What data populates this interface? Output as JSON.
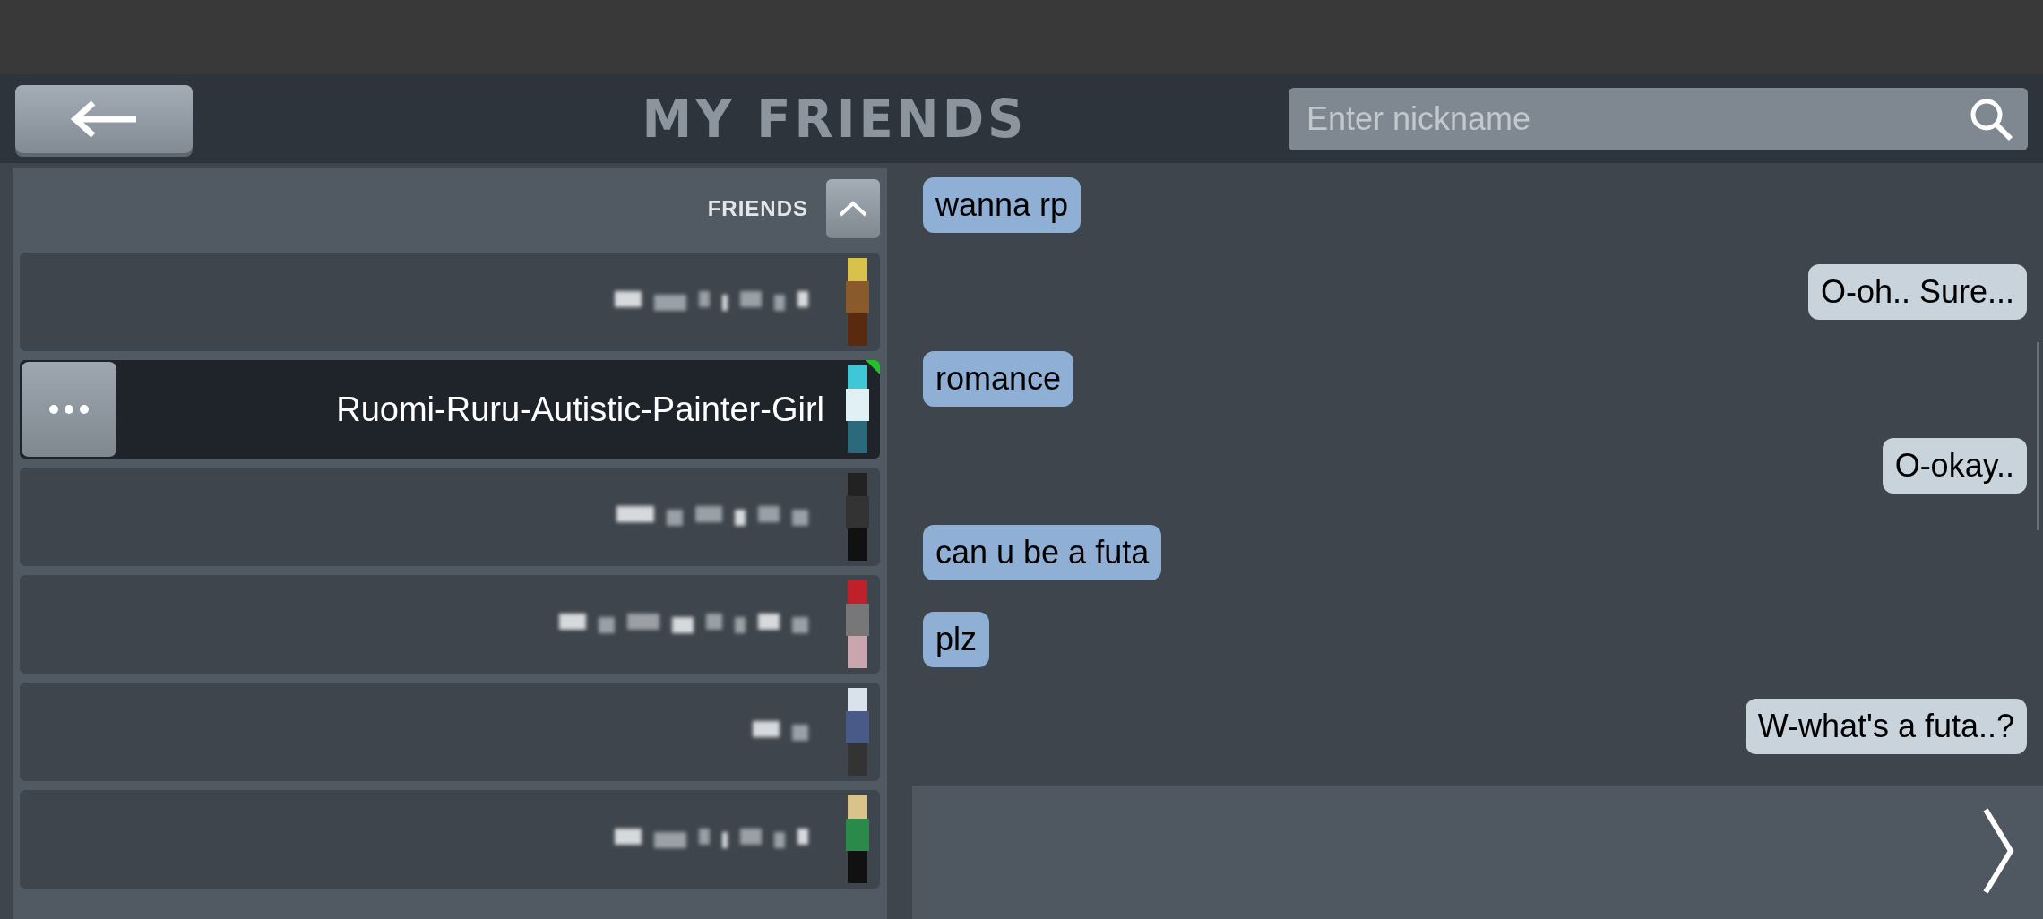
{
  "header": {
    "title": "MY FRIENDS",
    "search": {
      "placeholder": "Enter nickname"
    }
  },
  "friends": {
    "label": "FRIENDS",
    "expanded": true,
    "items": [
      {
        "kind": "blurred",
        "selected": false,
        "online": false
      },
      {
        "kind": "named",
        "name": "Ruomi-Ruru-Autistic-Painter-Girl",
        "selected": true,
        "online": true
      },
      {
        "kind": "blurred",
        "selected": false,
        "online": false
      },
      {
        "kind": "blurred",
        "selected": false,
        "online": false
      },
      {
        "kind": "blurred",
        "selected": false,
        "online": false
      },
      {
        "kind": "blurred",
        "selected": false,
        "online": false
      }
    ]
  },
  "messages": [
    {
      "text": "wanna rp",
      "kind": "incoming"
    },
    {
      "text": "O-oh.. Sure...",
      "kind": "outgoing"
    },
    {
      "text": "romance",
      "kind": "incoming"
    },
    {
      "text": "O-okay..",
      "kind": "outgoing"
    },
    {
      "text": "can u be a futa",
      "kind": "incoming"
    },
    {
      "text": "plz",
      "kind": "incoming"
    },
    {
      "text": "W-what's a futa..?",
      "kind": "outgoing"
    }
  ]
}
